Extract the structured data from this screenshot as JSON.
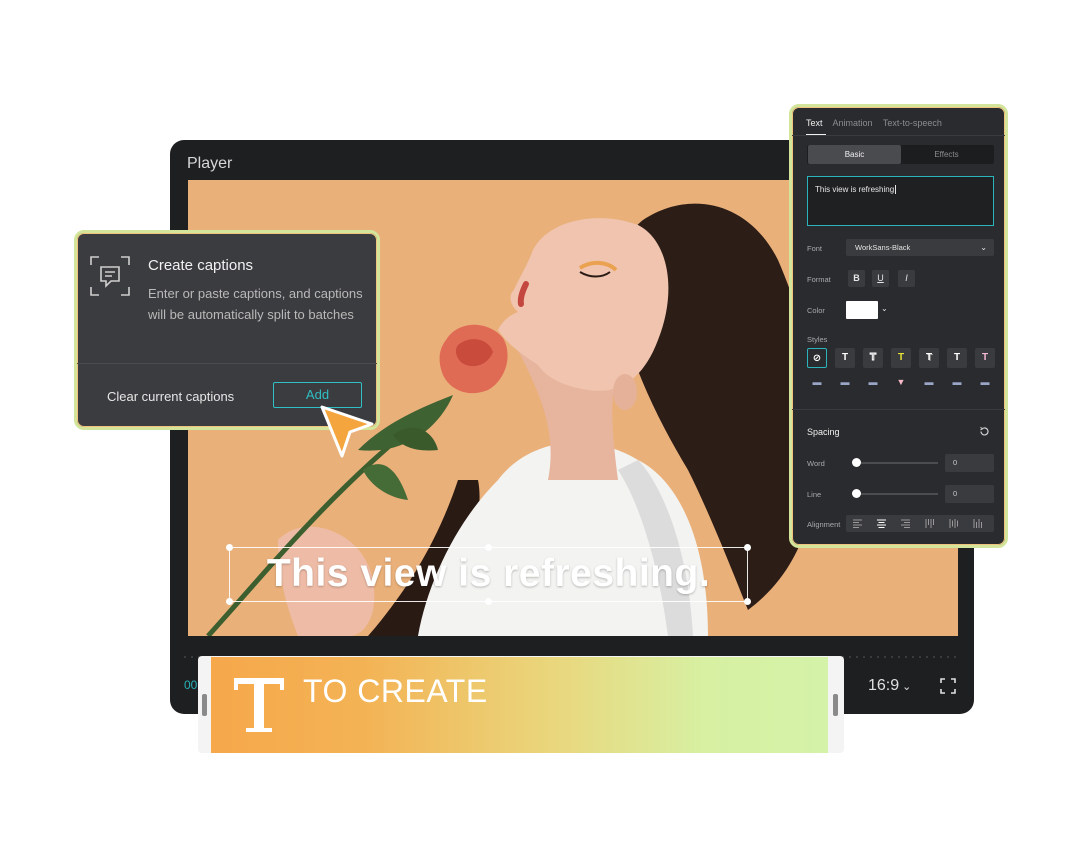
{
  "player": {
    "title": "Player",
    "timecode": "00",
    "aspect_ratio": "16:9",
    "aspect_chevron": "⌄"
  },
  "video_caption": "This view is refreshing.",
  "captions_popup": {
    "title": "Create captions",
    "description": "Enter or paste captions, and captions will be automatically split to batches",
    "clear_label": "Clear current captions",
    "add_label": "Add"
  },
  "text_panel": {
    "tabs": [
      "Text",
      "Animation",
      "Text-to-speech"
    ],
    "active_tab": "Text",
    "segments": [
      "Basic",
      "Effects"
    ],
    "text_value": "This view is refreshing",
    "font_label": "Font",
    "font_value": "WorkSans-Black",
    "format_label": "Format",
    "format_buttons": [
      "B",
      "U",
      "I"
    ],
    "color_label": "Color",
    "color_value": "#ffffff",
    "styles_label": "Styles",
    "styles": [
      "⊘",
      "T",
      "T",
      "T",
      "T",
      "T",
      "T"
    ],
    "spacing_title": "Spacing",
    "word_label": "Word",
    "word_value": "0",
    "line_label": "Line",
    "line_value": "0",
    "alignment_label": "Alignment"
  },
  "banner": {
    "text": "TO CREATE",
    "icon_letter": "T"
  },
  "colors": {
    "accent_teal": "#2fbfc4",
    "highlight_border": "#d3e59b",
    "banner_orange": "#f6a84b",
    "banner_green": "#d4f3a8"
  }
}
